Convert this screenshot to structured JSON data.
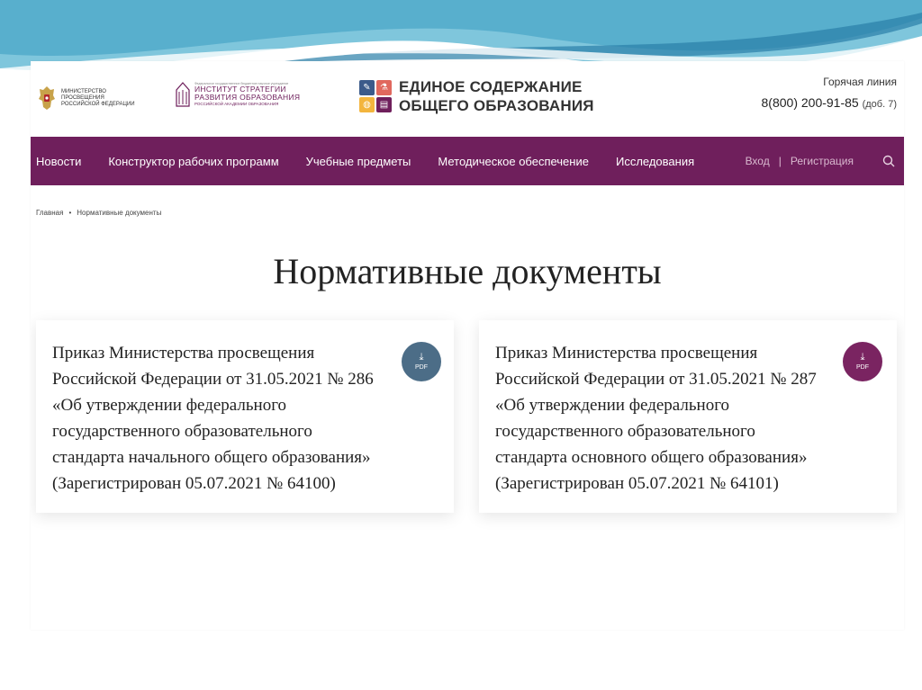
{
  "header": {
    "ministry_text": "Министерство просвещения Российской Федерации",
    "institute_top": "Федеральное государственное бюджетное научное учреждение",
    "institute_name_line1": "ИНСТИТУТ СТРАТЕГИИ",
    "institute_name_line2": "РАЗВИТИЯ ОБРАЗОВАНИЯ",
    "institute_sub": "РОССИЙСКОЙ АКАДЕМИИ ОБРАЗОВАНИЯ",
    "main_title_line1": "ЕДИНОЕ СОДЕРЖАНИЕ",
    "main_title_line2": "ОБЩЕГО ОБРАЗОВАНИЯ",
    "hotline_label": "Горячая линия",
    "hotline_phone": "8(800) 200-91-85",
    "hotline_ext": "(доб. 7)",
    "tile_colors": [
      "#3b5a8a",
      "#e0685e",
      "#f3b53d",
      "#6f1f5c"
    ]
  },
  "nav": {
    "items": [
      {
        "label": "Новости"
      },
      {
        "label": "Конструктор рабочих программ"
      },
      {
        "label": "Учебные предметы"
      },
      {
        "label": "Методическое обеспечение"
      },
      {
        "label": "Исследования"
      }
    ],
    "login": "Вход",
    "separator": "|",
    "register": "Регистрация",
    "background_color": "#6f1f5c"
  },
  "breadcrumb": {
    "home": "Главная",
    "separator": "•",
    "current": "Нормативные документы"
  },
  "page_title": "Нормативные документы",
  "documents": [
    {
      "text": "Приказ Министерства просвещения Российской Федерации от 31.05.2021 № 286 «Об утверждении федерального государственного образовательного стандарта начального общего образования» (Зарегистрирован 05.07.2021 № 64100)",
      "pdf_label": "PDF",
      "pdf_color": "#4c6d87"
    },
    {
      "text": "Приказ Министерства просвещения Российской Федерации от 31.05.2021 № 287 «Об утверждении федерального государственного образовательного стандарта основного общего образования» (Зарегистрирован 05.07.2021 № 64101)",
      "pdf_label": "PDF",
      "pdf_color": "#7a2461"
    }
  ],
  "icons": {
    "emblem": "coat-of-arms-icon",
    "search": "search-icon",
    "download": "download-icon"
  }
}
